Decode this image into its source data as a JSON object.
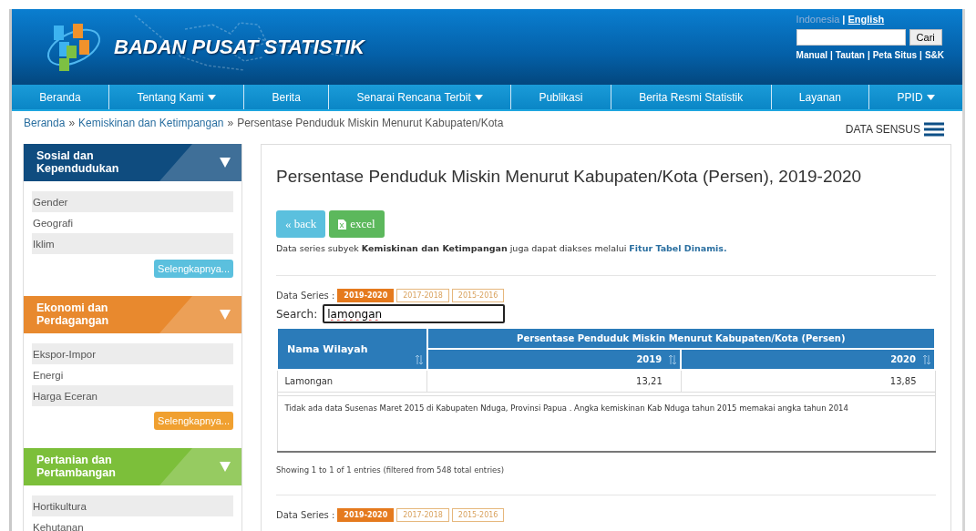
{
  "header": {
    "site_name": "BADAN PUSAT STATISTIK",
    "languages": [
      {
        "label": "Indonesia",
        "selected": true
      },
      {
        "separator": "|",
        "label": "English",
        "selected": false
      }
    ],
    "search_button": "Cari",
    "links": [
      {
        "label": "Manual"
      },
      {
        "separator": "|",
        "label": "Tautan"
      },
      {
        "separator": "|",
        "label": "Peta Situs"
      },
      {
        "separator": "|",
        "label": "S&K"
      }
    ]
  },
  "nav": [
    {
      "label": "Beranda",
      "dropdown": false
    },
    {
      "label": "Tentang Kami",
      "dropdown": true
    },
    {
      "label": "Berita",
      "dropdown": false
    },
    {
      "label": "Senarai Rencana Terbit",
      "dropdown": true
    },
    {
      "label": "Publikasi",
      "dropdown": false
    },
    {
      "label": "Berita Resmi Statistik",
      "dropdown": false
    },
    {
      "label": "Layanan",
      "dropdown": false
    },
    {
      "label": "PPID",
      "dropdown": true
    }
  ],
  "breadcrumb": [
    {
      "label": "Beranda"
    },
    {
      "separator": "»",
      "label": "Kemiskinan dan Ketimpangan"
    },
    {
      "separator": "»",
      "label": "Persentase Penduduk Miskin Menurut Kabupaten/Kota"
    }
  ],
  "data_sensus": "DATA SENSUS",
  "sidebar": [
    {
      "title": "Sosial dan Kependudukan",
      "color": "#0f4c7f",
      "items": [
        "Gender",
        "Geografi",
        "Iklim"
      ],
      "more": "Selengkapnya..."
    },
    {
      "title": "Ekonomi dan Perdagangan",
      "color": "#e8892e",
      "items": [
        "Ekspor-Impor",
        "Energi",
        "Harga Eceran"
      ],
      "more": "Selengkapnya..."
    },
    {
      "title": "Pertanian dan Pertambangan",
      "color": "#7cbf3a",
      "items": [
        "Hortikultura",
        "Kehutanan"
      ]
    }
  ],
  "content": {
    "title": "Persentase Penduduk Miskin Menurut Kabupaten/Kota (Persen), 2019-2020",
    "back_button": "« back",
    "excel_button": "excel",
    "info": "Data series subyek **Kemiskinan dan Ketimpangan** juga dapat diakses melalui ",
    "info_link": "Fitur Tabel Dinamis.",
    "series_label": "Data Series :",
    "series": [
      {
        "label": "2019-2020",
        "selected": true
      },
      {
        "label": "2017-2018",
        "selected": false
      },
      {
        "label": "2015-2016",
        "selected": false
      }
    ],
    "series_label_bottom": "Data Series :",
    "series_bottom": [
      {
        "label": "2019-2020",
        "selected": true
      },
      {
        "label": "2017-2018",
        "selected": false
      },
      {
        "label": "2015-2016",
        "selected": false
      }
    ],
    "search_label": "Search:",
    "search_value": "lamongan",
    "table": {
      "region_header": "Nama Wilayah",
      "group_header": "Persentase Penduduk Miskin Menurut Kabupaten/Kota (Persen)",
      "years": [
        "2019",
        "2020"
      ],
      "rows": [
        {
          "region": "Lamongan",
          "values": [
            "13,21",
            "13,85"
          ]
        }
      ],
      "note": "Tidak ada data Susenas Maret 2015 di Kabupaten Nduga, Provinsi Papua . Angka kemiskinan Kab Nduga tahun 2015 memakai angka tahun 2014"
    },
    "info_text": "Showing 1 to 1 of 1 entries (filtered from 548 total entries)"
  }
}
